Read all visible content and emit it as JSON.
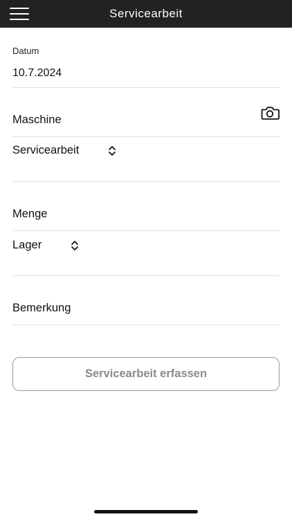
{
  "header": {
    "title": "Servicearbeit",
    "menu_icon": "hamburger-icon"
  },
  "form": {
    "datum_label": "Datum",
    "datum_value": "10.7.2024",
    "maschine_label": "Maschine",
    "camera_icon": "camera-icon",
    "servicearbeit_select_value": "Servicearbeit",
    "menge_label": "Menge",
    "lager_select_value": "Lager",
    "bemerkung_label": "Bemerkung",
    "submit_label": "Servicearbeit erfassen"
  },
  "colors": {
    "header_bg": "#222222",
    "divider": "#e2e2e2",
    "button_border": "#9a9a9a",
    "button_text": "#8a8a8a"
  }
}
